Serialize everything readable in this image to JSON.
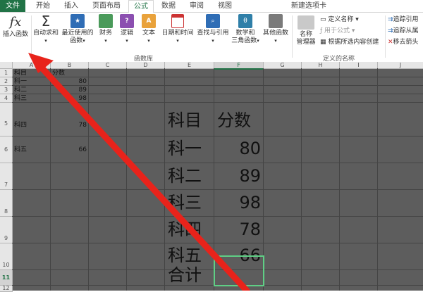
{
  "tabs": [
    "文件",
    "开始",
    "插入",
    "页面布局",
    "公式",
    "数据",
    "审阅",
    "视图",
    "新建选项卡"
  ],
  "ribbon": {
    "insert_function": "插入函数",
    "insert_function_symbol": "fx",
    "autosum": "自动求和",
    "recent_1": "最近使用的",
    "recent_2": "函数",
    "finance": "财务",
    "logic": "逻辑",
    "text": "文本",
    "datetime": "日期和时间",
    "lookup": "查找与引用",
    "math_1": "数学和",
    "math_2": "三角函数",
    "other": "其他函数",
    "library_label": "函数库",
    "name_mgr_1": "名称",
    "name_mgr_2": "管理器",
    "define_name": "定义名称",
    "use_in_formula": "用于公式",
    "create_from_sel": "根据所选内容创建",
    "names_label": "定义的名称",
    "trace_precedents": "追踪引用",
    "trace_dependents": "追踪从属",
    "remove_arrows": "移去箭头"
  },
  "columns": [
    "A",
    "B",
    "C",
    "D",
    "E",
    "F",
    "G",
    "H",
    "I",
    "J"
  ],
  "rows": [
    "1",
    "2",
    "3",
    "4",
    "5",
    "6",
    "7",
    "8",
    "9",
    "10",
    "11",
    "12"
  ],
  "small_table": {
    "h1": "科目",
    "h2": "分数",
    "r1": [
      "科一",
      "80"
    ],
    "r2": [
      "科二",
      "89"
    ],
    "r3": [
      "科三",
      "98"
    ],
    "r4": [
      "科四",
      "78"
    ],
    "r5": [
      "科五",
      "66"
    ]
  },
  "big_table": {
    "h1": "科目",
    "h2": "分数",
    "rows": [
      [
        "科一",
        "80"
      ],
      [
        "科二",
        "89"
      ],
      [
        "科三",
        "98"
      ],
      [
        "科四",
        "78"
      ],
      [
        "科五",
        "66"
      ]
    ],
    "total": "合计"
  },
  "colors": {
    "accent": "#217346",
    "sheet_bg": "#5d5d5d",
    "arrow": "#e8231b",
    "selection": "#5fcf85"
  }
}
